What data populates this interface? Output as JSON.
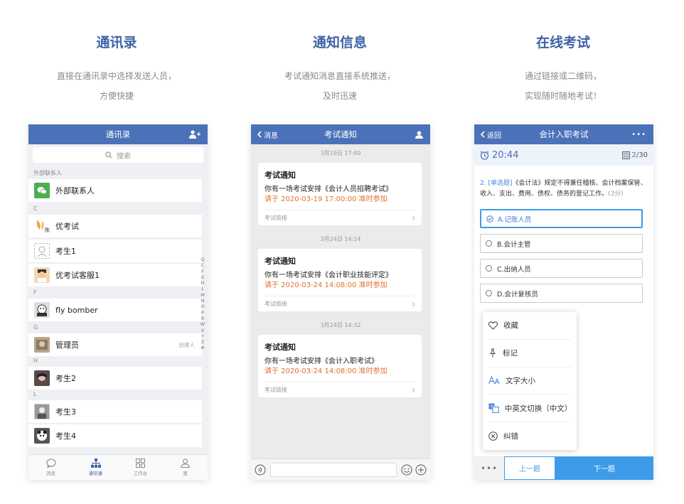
{
  "columns": [
    {
      "title": "通讯录",
      "desc1": "直接在通讯录中选择发送人员，",
      "desc2": "方便快捷"
    },
    {
      "title": "通知信息",
      "desc1": "考试通知消息直接系统推送，",
      "desc2": "及时迅速"
    },
    {
      "title": "在线考试",
      "desc1": "通过链接或二维码，",
      "desc2": "实现随时随地考试！"
    }
  ],
  "contacts": {
    "nav_title": "通讯录",
    "search_placeholder": "搜索",
    "sections": [
      "外部联系人",
      "C",
      "F",
      "G",
      "H",
      "L"
    ],
    "items": [
      {
        "name": "外部联系人"
      },
      {
        "name": "优考试",
        "avatar_text": "陈"
      },
      {
        "name": "考生1"
      },
      {
        "name": "优考试客服1"
      },
      {
        "name": "fly bomber"
      },
      {
        "name": "管理员",
        "tag": "创建人"
      },
      {
        "name": "考生2"
      },
      {
        "name": "考生3"
      },
      {
        "name": "考生4"
      }
    ],
    "alpha_index": [
      "Q",
      "C",
      "F",
      "G",
      "H",
      "L",
      "M",
      "N",
      "O",
      "P",
      "R",
      "W",
      "X",
      "Y",
      "Z",
      "#"
    ],
    "tabs": [
      {
        "label": "消息",
        "icon": "chat-icon"
      },
      {
        "label": "通讯录",
        "icon": "org-icon"
      },
      {
        "label": "工作台",
        "icon": "grid-icon"
      },
      {
        "label": "我",
        "icon": "person-icon"
      }
    ]
  },
  "notices": {
    "back_label": "消息",
    "nav_title": "考试通知",
    "messages": [
      {
        "time": "3月19日 17:40",
        "title": "考试通知",
        "body": "你有一场考试安排《会计人员招聘考试》",
        "deadline": "请于 2020-03-19 17:00:00 准时参加",
        "link": "考试链接"
      },
      {
        "time": "3月24日 14:14",
        "title": "考试通知",
        "body": "你有一场考试安排《会计职业技能评定》",
        "deadline": "请于 2020-03-24 14:08:00 准时参加",
        "link": "考试链接"
      },
      {
        "time": "3月24日 14:32",
        "title": "考试通知",
        "body": "你有一场考试安排《会计入职考试》",
        "deadline": "请于 2020-03-24 14:08:00 准时参加",
        "link": "考试链接"
      }
    ]
  },
  "exam": {
    "back_label": "返回",
    "nav_title": "会计入职考试",
    "more_label": "•••",
    "timer": "20:44",
    "progress_current": "2",
    "progress_total": "/30",
    "question": {
      "number": "2. ",
      "type": "[单选题]",
      "text": "《会计法》规定不得兼任稽核、会计档案保管、收入、支出、费用、债权、债务的登记工作。",
      "score": "(3分)"
    },
    "options": [
      {
        "label": "A.记账人员",
        "selected": true
      },
      {
        "label": "B.会计主管",
        "selected": false
      },
      {
        "label": "C.出纳人员",
        "selected": false
      },
      {
        "label": "D.会计复核员",
        "selected": false
      }
    ],
    "menu": [
      {
        "label": "收藏",
        "icon": "heart-icon"
      },
      {
        "label": "标记",
        "icon": "pin-icon"
      },
      {
        "label": "文字大小",
        "icon": "font-size-icon"
      },
      {
        "label": "中英文切换（中文）",
        "icon": "translate-icon"
      },
      {
        "label": "纠错",
        "icon": "error-icon"
      }
    ],
    "bottom_more": "•••",
    "prev_label": "上一题",
    "next_label": "下一题"
  }
}
